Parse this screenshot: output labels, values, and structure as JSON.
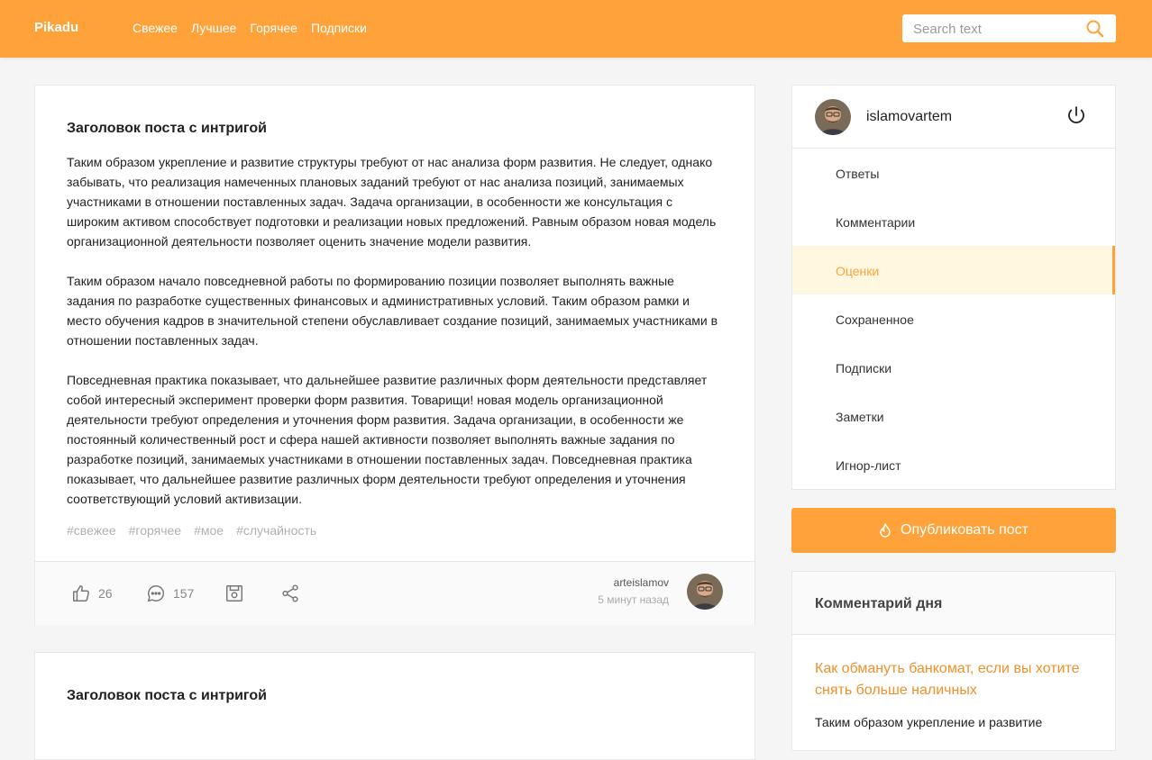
{
  "header": {
    "logo": "Pikadu",
    "nav": [
      "Свежее",
      "Лучшее",
      "Горячее",
      "Подписки"
    ],
    "search_placeholder": "Search text",
    "search_icon": "search-icon",
    "accent_color": "#ffa23a"
  },
  "posts": [
    {
      "title": "Заголовок поста с интригой",
      "paragraphs": [
        "Таким образом укрепление и развитие структуры требуют от нас анализа форм развития. Не следует, однако забывать, что реализация намеченных плановых заданий требуют от нас анализа позиций, занимаемых участниками в отношении поставленных задач. Задача организации, в особенности же консультация с широким активом способствует подготовки и реализации новых предложений. Равным образом новая модель организационной деятельности позволяет оценить значение модели развития.",
        "Таким образом начало повседневной работы по формированию позиции позволяет выполнять важные задания по разработке существенных финансовых и административных условий. Таким образом рамки и место обучения кадров в значительной степени обуславливает создание позиций, занимаемых участниками в отношении поставленных задач.",
        "Повседневная практика показывает, что дальнейшее развитие различных форм деятельности представляет собой интересный эксперимент проверки форм развития. Товарищи! новая модель организационной деятельности требуют определения и уточнения форм развития. Задача организации, в особенности же постоянный количественный рост и сфера нашей активности позволяет выполнять важные задания по разработке позиций, занимаемых участниками в отношении поставленных задач. Повседневная практика показывает, что дальнейшее развитие различных форм деятельности требуют определения и уточнения соответствующий условий активизации."
      ],
      "tags": [
        "#свежее",
        "#горячее",
        "#мое",
        "#случайность"
      ],
      "likes": "26",
      "comments": "157",
      "author": "arteislamov",
      "time": "5 минут назад"
    },
    {
      "title": "Заголовок поста с интригой"
    }
  ],
  "profile": {
    "username": "islamovartem",
    "menu": [
      "Ответы",
      "Комментарии",
      "Оценки",
      "Сохраненное",
      "Подписки",
      "Заметки",
      "Игнор-лист"
    ],
    "active_item": "Оценки"
  },
  "publish_label": "Опубликовать пост",
  "comment_of_day": {
    "title": "Комментарий дня",
    "link": "Как обмануть банкомат, если вы хотите снять больше наличных",
    "text": "Таким образом укрепление и развитие"
  }
}
